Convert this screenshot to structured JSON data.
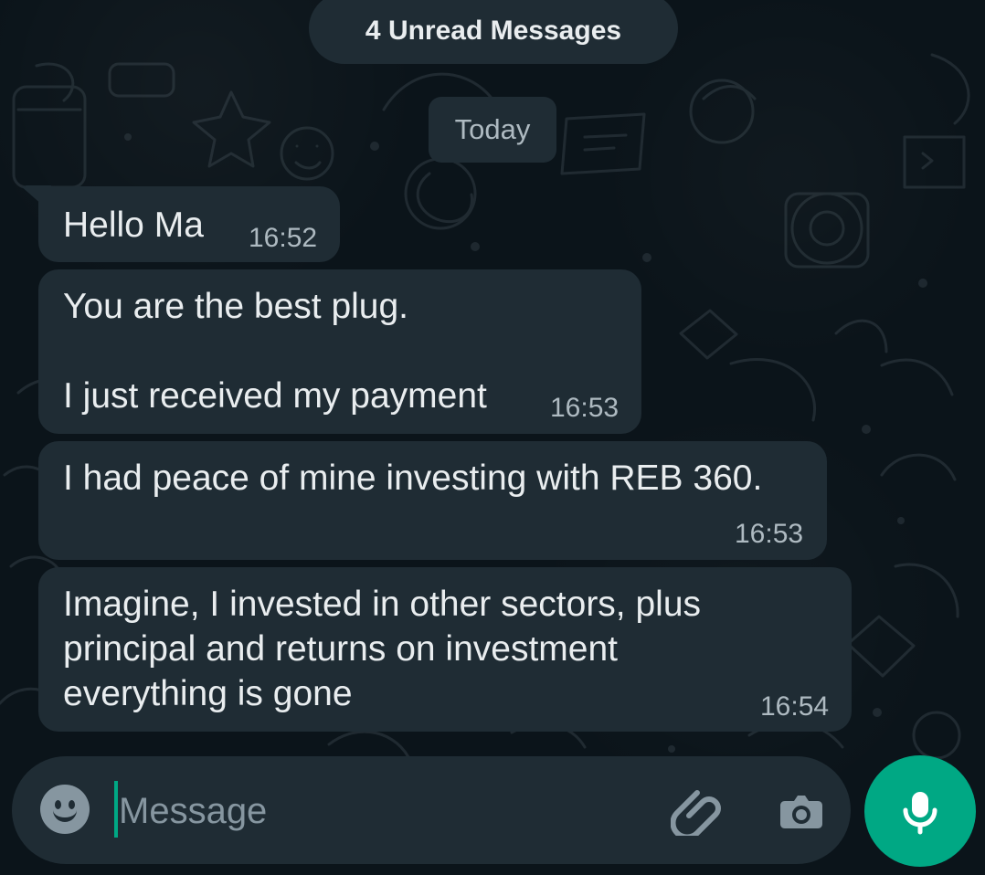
{
  "top_notice": {
    "unread": "4 Unread Messages"
  },
  "date_chip": {
    "label": "Today"
  },
  "messages": [
    {
      "text": "Hello Ma",
      "time": "16:52"
    },
    {
      "text": "You are the best plug.\n\nI just received my payment",
      "time": "16:53"
    },
    {
      "text": "I had peace of mine investing with REB 360.",
      "time": "16:53"
    },
    {
      "text": "Imagine, I invested in other sectors, plus\nprincipal and returns on investment\neverything is gone",
      "time": "16:54"
    }
  ],
  "composer": {
    "placeholder": "Message"
  },
  "icons": {
    "emoji": "emoji-icon",
    "attach": "paperclip-icon",
    "camera": "camera-icon",
    "mic": "microphone-icon"
  },
  "colors": {
    "background": "#0b141a",
    "bubble": "#1f2c34",
    "accent": "#00a884",
    "secondary_text": "#aebac1",
    "icon": "#8696a0"
  }
}
